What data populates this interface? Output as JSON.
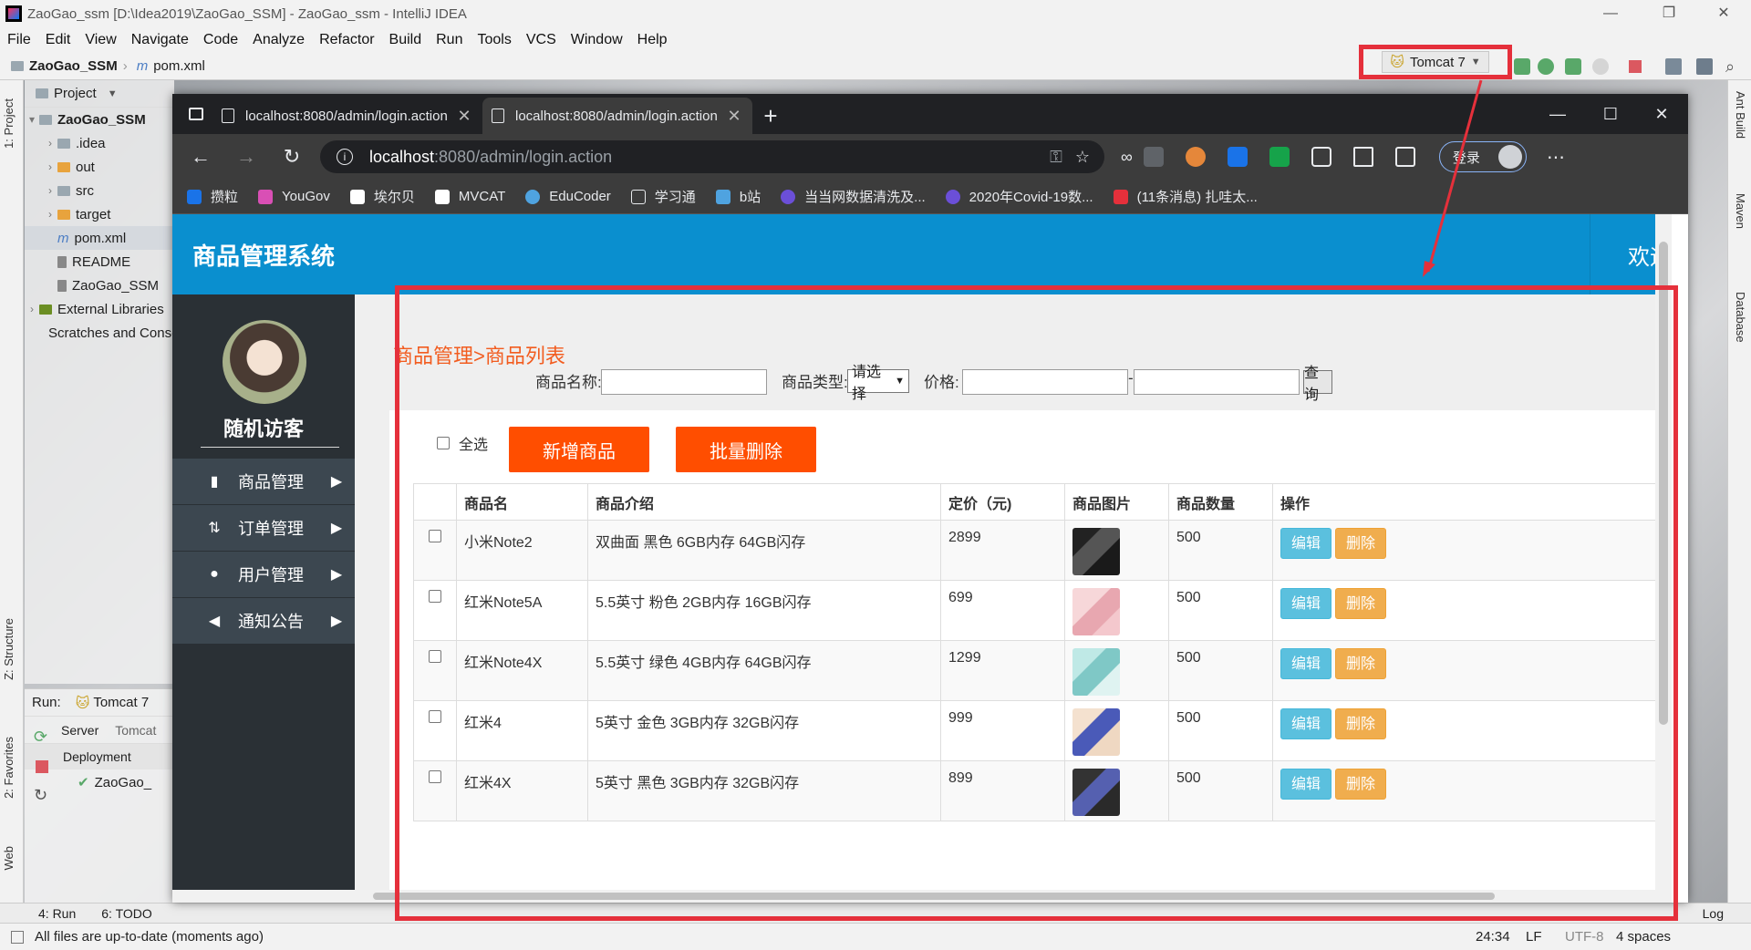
{
  "ide": {
    "title": "ZaoGao_ssm [D:\\Idea2019\\ZaoGao_SSM] - ZaoGao_ssm - IntelliJ IDEA",
    "menu": [
      "File",
      "Edit",
      "View",
      "Navigate",
      "Code",
      "Analyze",
      "Refactor",
      "Build",
      "Run",
      "Tools",
      "VCS",
      "Window",
      "Help"
    ],
    "breadcrumb_project": "ZaoGao_SSM",
    "breadcrumb_file": "pom.xml",
    "run_config": "Tomcat 7",
    "left_tool_labels": [
      "1: Project",
      "Z: Structure",
      "2: Favorites",
      "Web"
    ],
    "right_tool_labels": [
      "Ant Build",
      "Maven",
      "Database"
    ],
    "project_header": "Project",
    "tree": [
      {
        "label": "ZaoGao_SSM",
        "bold": true
      },
      {
        "label": ".idea"
      },
      {
        "label": "out"
      },
      {
        "label": "src"
      },
      {
        "label": "target"
      },
      {
        "label": "pom.xml"
      },
      {
        "label": "README"
      },
      {
        "label": "ZaoGao_SSM"
      },
      {
        "label": "External Libraries"
      },
      {
        "label": "Scratches and Consoles"
      }
    ],
    "run_label": "Run:",
    "run_tab": "Tomcat 7",
    "server_tab": "Server",
    "tomcat_tab": "Tomcat",
    "deployment": "Deployment",
    "deploy_item": "ZaoGao_",
    "bottom_tabs": [
      "4: Run",
      "6: TODO"
    ],
    "event_log": "Log",
    "status_message": "All files are up-to-date (moments ago)",
    "cursor_pos": "24:34",
    "line_sep": "LF",
    "encoding": "UTF-8",
    "indent": "4 spaces"
  },
  "browser": {
    "tabs": [
      {
        "title": "localhost:8080/admin/login.action"
      },
      {
        "title": "localhost:8080/admin/login.action"
      }
    ],
    "url_host": "localhost",
    "url_path": ":8080/admin/login.action",
    "login_label": "登录",
    "bookmarks": [
      "攒粒",
      "YouGov",
      "埃尔贝",
      "MVCAT",
      "EduCoder",
      "学习通",
      "b站",
      "当当网数据清洗及...",
      "2020年Covid-19数...",
      "(11条消息) 扎哇太..."
    ]
  },
  "app": {
    "brand": "商品管理系统",
    "welcome": "欢迎",
    "user": "随机访客",
    "menu": [
      {
        "label": "商品管理"
      },
      {
        "label": "订单管理"
      },
      {
        "label": "用户管理"
      },
      {
        "label": "通知公告"
      }
    ],
    "breadcrumb": "商品管理>商品列表",
    "filters": {
      "name_label": "商品名称:",
      "type_label": "商品类型:",
      "type_value": "请选择",
      "price_label": "价格:",
      "search_button": "查询"
    },
    "select_all": "全选",
    "add_button": "新增商品",
    "batch_delete_button": "批量删除",
    "table": {
      "headers": [
        "",
        "商品名",
        "商品介绍",
        "定价（元)",
        "商品图片",
        "商品数量",
        "操作"
      ],
      "rows": [
        {
          "name": "小米Note2",
          "desc": "双曲面 黑色 6GB内存 64GB闪存",
          "price": "2899",
          "qty": "500"
        },
        {
          "name": "红米Note5A",
          "desc": "5.5英寸 粉色 2GB内存 16GB闪存",
          "price": "699",
          "qty": "500"
        },
        {
          "name": "红米Note4X",
          "desc": "5.5英寸 绿色 4GB内存 64GB闪存",
          "price": "1299",
          "qty": "500"
        },
        {
          "name": "红米4",
          "desc": "5英寸 金色 3GB内存 32GB闪存",
          "price": "999",
          "qty": "500"
        },
        {
          "name": "红米4X",
          "desc": "5英寸 黑色 3GB内存 32GB闪存",
          "price": "899",
          "qty": "500"
        }
      ],
      "edit_label": "编辑",
      "delete_label": "删除"
    }
  },
  "colors": {
    "header_blue": "#0a8fcf",
    "sidebar_dark": "#2a3035",
    "accent_orange": "#ff4e00",
    "highlight_red": "#e5303b",
    "edit_blue": "#5bc0de",
    "delete_orange": "#f0ad4e"
  }
}
